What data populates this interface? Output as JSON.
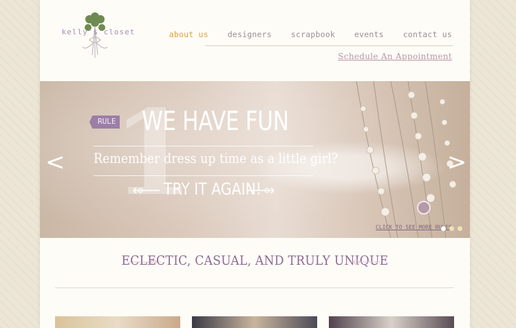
{
  "brand": {
    "name": "kelly's closet",
    "logo_icon": "four-leaf-flower-bouquet"
  },
  "nav": {
    "items": [
      {
        "label": "about us",
        "active": true
      },
      {
        "label": "designers",
        "active": false
      },
      {
        "label": "scrapbook",
        "active": false
      },
      {
        "label": "events",
        "active": false
      },
      {
        "label": "contact us",
        "active": false
      }
    ],
    "active_color": "#e0a23a"
  },
  "appointment_link": "Schedule An Appointment",
  "hero": {
    "rule_tag": "RULE",
    "rule_number": "1",
    "headline": "WE HAVE FUN",
    "subline": "Remember dress up time as a little girl?",
    "cta": "TRY IT AGAIN!",
    "click_more": "CLICK TO SEE MORE RULES",
    "prev_arrow": "<",
    "next_arrow": ">",
    "slides_total": 3,
    "active_slide": 1
  },
  "tagline": "ECLECTIC, CASUAL, AND TRULY UNIQUE",
  "colors": {
    "accent_purple": "#9c7ea6",
    "page_bg": "#fdfcf6",
    "tagline": "#8d6a97"
  }
}
